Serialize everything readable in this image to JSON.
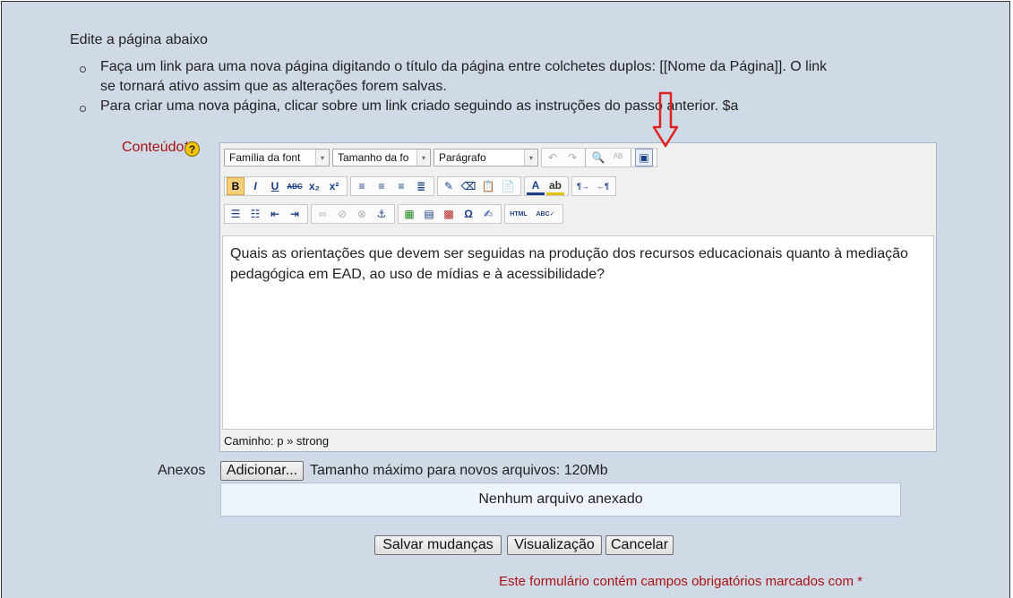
{
  "page": {
    "heading": "Edite a página abaixo",
    "instructions": [
      "Faça um link para uma nova página digitando o título da página entre colchetes duplos: [[Nome da Página]]. O link",
      "se tornará ativo assim que as alterações forem salvas.",
      "Para criar uma nova página, clicar sobre um link criado seguindo as instruções do passo anterior. $a"
    ]
  },
  "form": {
    "content_label": "Conteúdo",
    "required_mark": "*",
    "help_icon": "?",
    "attachments_label": "Anexos",
    "add_button": "Adicionar...",
    "max_size": "Tamanho máximo para novos arquivos: 120Mb",
    "no_files": "Nenhum arquivo anexado",
    "save_button": "Salvar mudanças",
    "preview_button": "Visualização",
    "cancel_button": "Cancelar",
    "required_note": "Este formulário contém campos obrigatórios marcados com",
    "required_note_mark": "*"
  },
  "editor": {
    "font_family": "Família da font",
    "font_size": "Tamanho da fo",
    "format": "Parágrafo",
    "dropdown_glyph": "▾",
    "content_text": "Quais as orientações que devem ser seguidas na produção dos recursos educacionais quanto à mediação pedagógica em EAD, ao uso de mídias e à acessibilidade?",
    "path_label": "Caminho: p » strong",
    "toolbar_row1": [
      {
        "name": "undo-icon",
        "glyph": "↶",
        "disabled": true
      },
      {
        "name": "redo-icon",
        "glyph": "↷",
        "disabled": true
      },
      {
        "name": "find-icon",
        "glyph": "🔍",
        "disabled": false
      },
      {
        "name": "replace-icon",
        "glyph": "ᴬᴮ",
        "disabled": true
      },
      {
        "name": "fullscreen-toggle-icon",
        "glyph": "▣",
        "disabled": false
      }
    ],
    "toolbar_row2": [
      {
        "name": "bold-icon",
        "glyph": "B"
      },
      {
        "name": "italic-icon",
        "glyph": "I"
      },
      {
        "name": "underline-icon",
        "glyph": "U"
      },
      {
        "name": "strikethrough-icon",
        "glyph": "ABC"
      },
      {
        "name": "subscript-icon",
        "glyph": "x₂"
      },
      {
        "name": "superscript-icon",
        "glyph": "x²"
      },
      {
        "name": "align-left-icon",
        "glyph": "≡"
      },
      {
        "name": "align-center-icon",
        "glyph": "≡"
      },
      {
        "name": "align-right-icon",
        "glyph": "≡"
      },
      {
        "name": "justify-icon",
        "glyph": "≣"
      },
      {
        "name": "clean-up-icon",
        "glyph": "✎"
      },
      {
        "name": "eraser-icon",
        "glyph": "⌫"
      },
      {
        "name": "paste-text-icon",
        "glyph": "📋"
      },
      {
        "name": "paste-word-icon",
        "glyph": "📄"
      },
      {
        "name": "text-color-icon",
        "glyph": "A"
      },
      {
        "name": "background-color-icon",
        "glyph": "ab"
      },
      {
        "name": "ltr-icon",
        "glyph": "¶→"
      },
      {
        "name": "rtl-icon",
        "glyph": "←¶"
      }
    ],
    "toolbar_row3": [
      {
        "name": "bullet-list-icon",
        "glyph": "☰"
      },
      {
        "name": "numbered-list-icon",
        "glyph": "☷"
      },
      {
        "name": "outdent-icon",
        "glyph": "⇤"
      },
      {
        "name": "indent-icon",
        "glyph": "⇥"
      },
      {
        "name": "link-icon",
        "glyph": "∞"
      },
      {
        "name": "unlink-icon",
        "glyph": "⊘"
      },
      {
        "name": "nolink-icon",
        "glyph": "⊗"
      },
      {
        "name": "anchor-icon",
        "glyph": "⚓"
      },
      {
        "name": "image-icon",
        "glyph": "▦"
      },
      {
        "name": "media-icon",
        "glyph": "▤"
      },
      {
        "name": "moodle-media-icon",
        "glyph": "▩"
      },
      {
        "name": "special-char-icon",
        "glyph": "Ω"
      },
      {
        "name": "emoticon-icon",
        "glyph": "✍"
      },
      {
        "name": "html-icon",
        "glyph": "HTML"
      },
      {
        "name": "spellcheck-icon",
        "glyph": "ABC✓"
      }
    ]
  },
  "colors": {
    "background": "#cfdae6",
    "required": "#aa1111",
    "annotation_arrow": "#e02020"
  }
}
